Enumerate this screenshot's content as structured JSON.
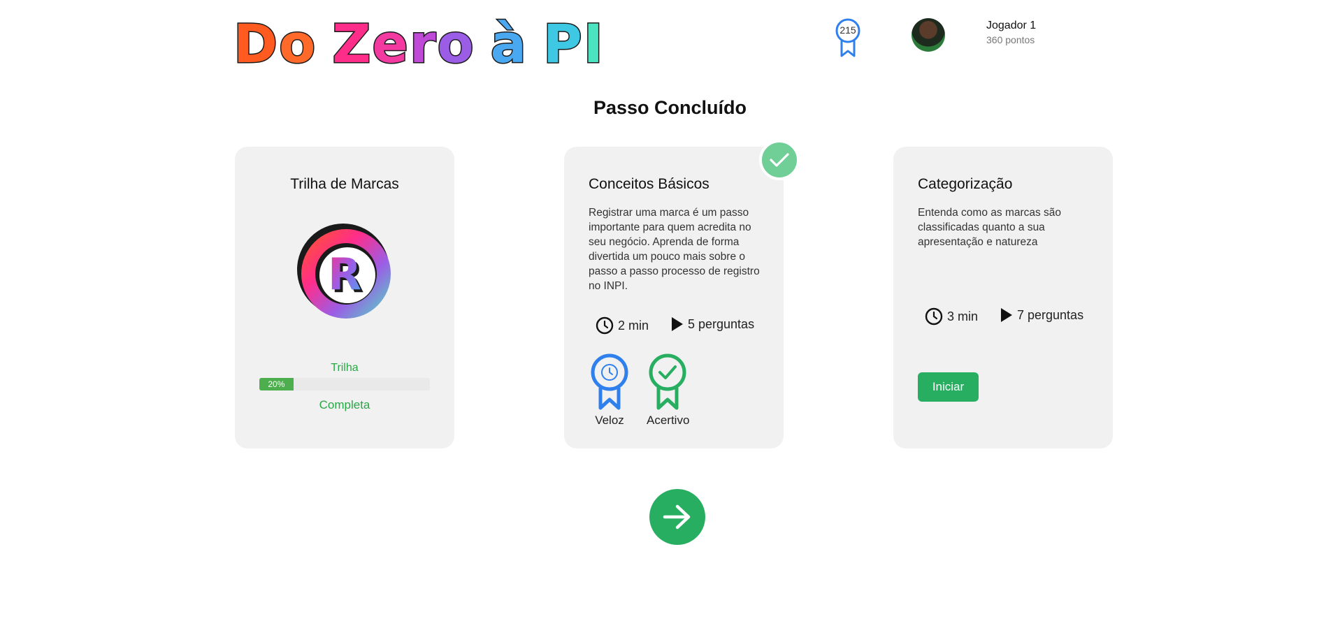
{
  "header": {
    "logo_text": "Do Zero à PI",
    "badge_count": "215",
    "player_name": "Jogador 1",
    "player_points": "360 pontos",
    "avatar_icon": "player-avatar"
  },
  "page_title": "Passo Concluído",
  "cards": [
    {
      "title": "Trilha de Marcas",
      "logo_icon": "registered-trademark-icon",
      "trail_label": "Trilha",
      "progress": 0.2,
      "progress_text": "20%",
      "complete_label": "Completa"
    },
    {
      "title": "Conceitos Básicos",
      "description": "Registrar uma marca é um passo importante para quem acredita no seu negócio. Aprenda de forma divertida um pouco mais sobre o passo a passo processo de registro no INPI.",
      "duration": "2 min",
      "questions": "5 perguntas",
      "completed": true,
      "medals": [
        {
          "label": "Veloz",
          "icon": "clock-medal-icon",
          "color": "#2f80ed"
        },
        {
          "label": "Acertivo",
          "icon": "check-medal-icon",
          "color": "#27ae60"
        }
      ]
    },
    {
      "title": "Categorização",
      "description": "Entenda como as marcas são classificadas quanto a sua apresentação e natureza",
      "duration": "3 min",
      "questions": "7 perguntas",
      "button_label": "Iniciar"
    }
  ],
  "colors": {
    "accent_green": "#27ae60",
    "check_green": "#6fcf97",
    "medal_blue": "#2f80ed",
    "card_bg": "#f1f1f1"
  },
  "next_button_icon": "arrow-right-icon"
}
